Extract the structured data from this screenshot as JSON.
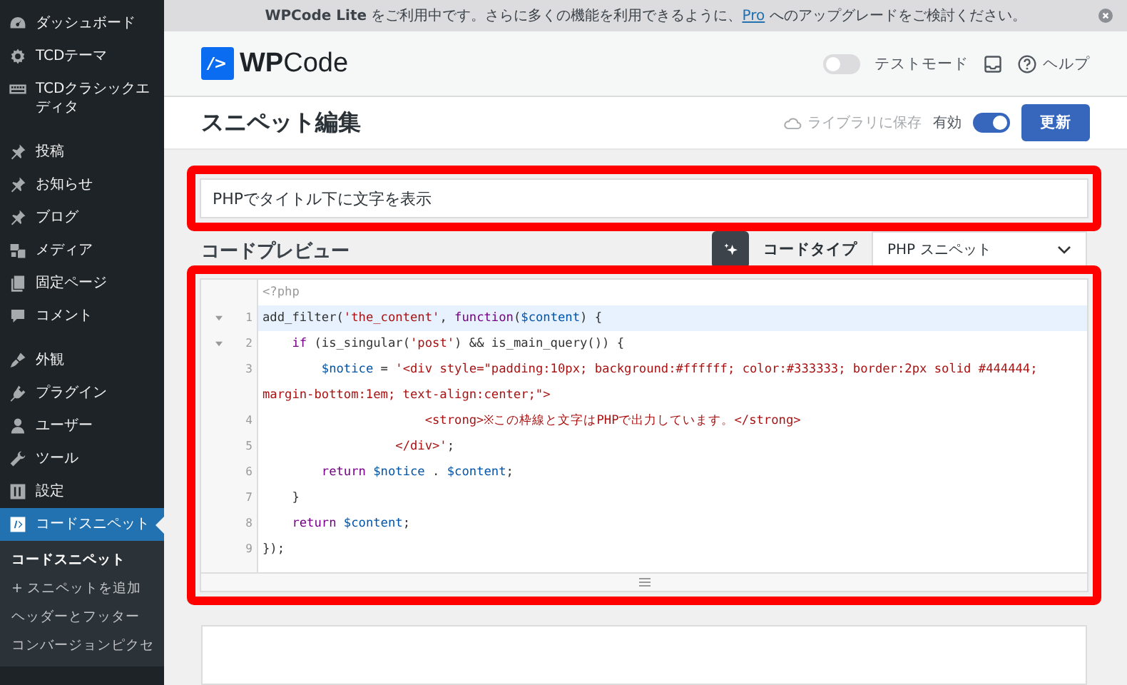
{
  "sidebar": {
    "groups": [
      [
        {
          "label": "ダッシュボード",
          "selected": false
        },
        {
          "label": "TCDテーマ",
          "selected": false
        },
        {
          "label": "TCDクラシックエディタ",
          "selected": false
        }
      ],
      [
        {
          "label": "投稿",
          "selected": false
        },
        {
          "label": "お知らせ",
          "selected": false
        },
        {
          "label": "ブログ",
          "selected": false
        },
        {
          "label": "メディア",
          "selected": false
        },
        {
          "label": "固定ページ",
          "selected": false
        },
        {
          "label": "コメント",
          "selected": false
        }
      ],
      [
        {
          "label": "外観",
          "selected": false
        },
        {
          "label": "プラグイン",
          "selected": false
        },
        {
          "label": "ユーザー",
          "selected": false
        },
        {
          "label": "ツール",
          "selected": false
        },
        {
          "label": "設定",
          "selected": false
        },
        {
          "label": "コードスニペット",
          "selected": true
        }
      ]
    ],
    "submenu": [
      {
        "label": "コードスニペット",
        "selected": true
      },
      {
        "label": "+ スニペットを追加",
        "selected": false
      },
      {
        "label": "ヘッダーとフッター",
        "selected": false
      },
      {
        "label": "コンバージョンピクセ",
        "selected": false
      }
    ]
  },
  "notice": {
    "text": "**WPCode Lite** をご利用中です。さらに多くの機能を利用できるように、",
    "link": "Pro",
    "text_after": " へのアップグレードをご検討ください。"
  },
  "header": {
    "logo_mark": "/>",
    "logo_bold": "WP",
    "logo_rest": "Code",
    "test_mode": {
      "label": "テストモード",
      "on": false
    },
    "help": "ヘルプ"
  },
  "title_bar": {
    "title": "スニペット編集",
    "save_library": "ライブラリに保存",
    "active": {
      "label": "有効",
      "on": true
    },
    "update_button": "更新"
  },
  "snippet_title": {
    "value": "PHPでタイトル下に文字を表示"
  },
  "code_preview": {
    "heading": "コードプレビュー",
    "code_type_label": "コードタイプ",
    "code_type": "PHP スニペット",
    "lines": [
      {
        "foldable": false,
        "selected": false,
        "tokens": [
          {
            "kind": "meta",
            "text": "<?php"
          }
        ]
      },
      {
        "number": "1",
        "foldable": true,
        "selected": true,
        "tokens": [
          {
            "kind": "plain",
            "text": "add_filter("
          },
          {
            "kind": "string",
            "text": "'the_content'"
          },
          {
            "kind": "plain",
            "text": ", "
          },
          {
            "kind": "keyword",
            "text": "function"
          },
          {
            "kind": "plain",
            "text": "("
          },
          {
            "kind": "variable",
            "text": "$content"
          },
          {
            "kind": "plain",
            "text": ") {"
          }
        ]
      },
      {
        "number": "2",
        "foldable": true,
        "selected": false,
        "tokens": [
          {
            "kind": "keyword",
            "text": "    if"
          },
          {
            "kind": "plain",
            "text": " (is_singular("
          },
          {
            "kind": "string",
            "text": "'post'"
          },
          {
            "kind": "plain",
            "text": ") && is_main_query()) {"
          }
        ]
      },
      {
        "number": "3",
        "foldable": false,
        "selected": false,
        "tokens": [
          {
            "kind": "variable",
            "text": "        $notice"
          },
          {
            "kind": "plain",
            "text": " = "
          },
          {
            "kind": "string",
            "text": "'<div style=\"padding:10px; background:#ffffff; color:#333333; border:2px solid #444444; margin-bottom:1em; text-align:center;\">"
          }
        ]
      },
      {
        "number": "4",
        "foldable": false,
        "selected": false,
        "tokens": [
          {
            "kind": "string",
            "text": "                      <strong>※この枠線と文字はPHPで出力しています。</strong>"
          }
        ]
      },
      {
        "number": "5",
        "foldable": false,
        "selected": false,
        "tokens": [
          {
            "kind": "string",
            "text": "                  </div>'"
          },
          {
            "kind": "plain",
            "text": ";"
          }
        ]
      },
      {
        "number": "6",
        "foldable": false,
        "selected": false,
        "tokens": [
          {
            "kind": "keyword",
            "text": "        return "
          },
          {
            "kind": "variable",
            "text": "$notice"
          },
          {
            "kind": "plain",
            "text": " . "
          },
          {
            "kind": "variable",
            "text": "$content"
          },
          {
            "kind": "plain",
            "text": ";"
          }
        ]
      },
      {
        "number": "7",
        "foldable": false,
        "selected": false,
        "tokens": [
          {
            "kind": "plain",
            "text": "    }"
          }
        ]
      },
      {
        "number": "8",
        "foldable": false,
        "selected": false,
        "tokens": [
          {
            "kind": "keyword",
            "text": "    return "
          },
          {
            "kind": "variable",
            "text": "$content"
          },
          {
            "kind": "plain",
            "text": ";"
          }
        ]
      },
      {
        "number": "9",
        "foldable": false,
        "selected": false,
        "tokens": [
          {
            "kind": "plain",
            "text": "});"
          }
        ]
      }
    ]
  }
}
